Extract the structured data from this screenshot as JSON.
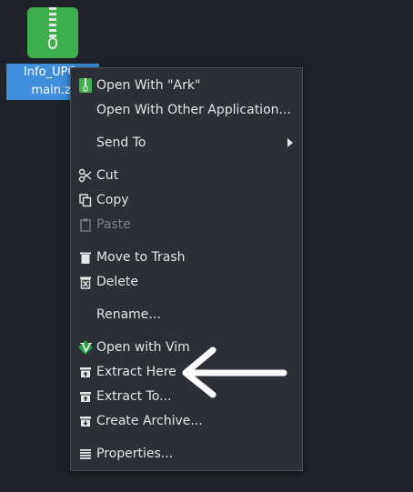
{
  "desktop": {
    "file": {
      "name_line1": "Info_UPC_",
      "name_line2": "main.zi",
      "icon": "zip-archive-icon"
    }
  },
  "context_menu": {
    "items": [
      {
        "label": "Open With \"Ark\"",
        "icon": "ark-icon"
      },
      {
        "label": "Open With Other Application...",
        "icon": ""
      },
      {
        "label": "Send To",
        "icon": "",
        "submenu": true
      },
      {
        "label": "Cut",
        "icon": "scissors-icon"
      },
      {
        "label": "Copy",
        "icon": "copy-icon"
      },
      {
        "label": "Paste",
        "icon": "clipboard-icon",
        "disabled": true
      },
      {
        "label": "Move to Trash",
        "icon": "trash-icon"
      },
      {
        "label": "Delete",
        "icon": "delete-icon"
      },
      {
        "label": "Rename...",
        "icon": ""
      },
      {
        "label": "Open with Vim",
        "icon": "vim-icon"
      },
      {
        "label": "Extract Here",
        "icon": "extract-icon"
      },
      {
        "label": "Extract To...",
        "icon": "extract-icon"
      },
      {
        "label": "Create Archive...",
        "icon": "archive-icon"
      },
      {
        "label": "Properties...",
        "icon": "properties-icon"
      }
    ]
  },
  "colors": {
    "background": "#1f2228",
    "menu_bg": "#2c2f35",
    "selection": "#3f8fdc",
    "zip_green": "#3fae4d",
    "vim_green": "#1f9e3a"
  }
}
